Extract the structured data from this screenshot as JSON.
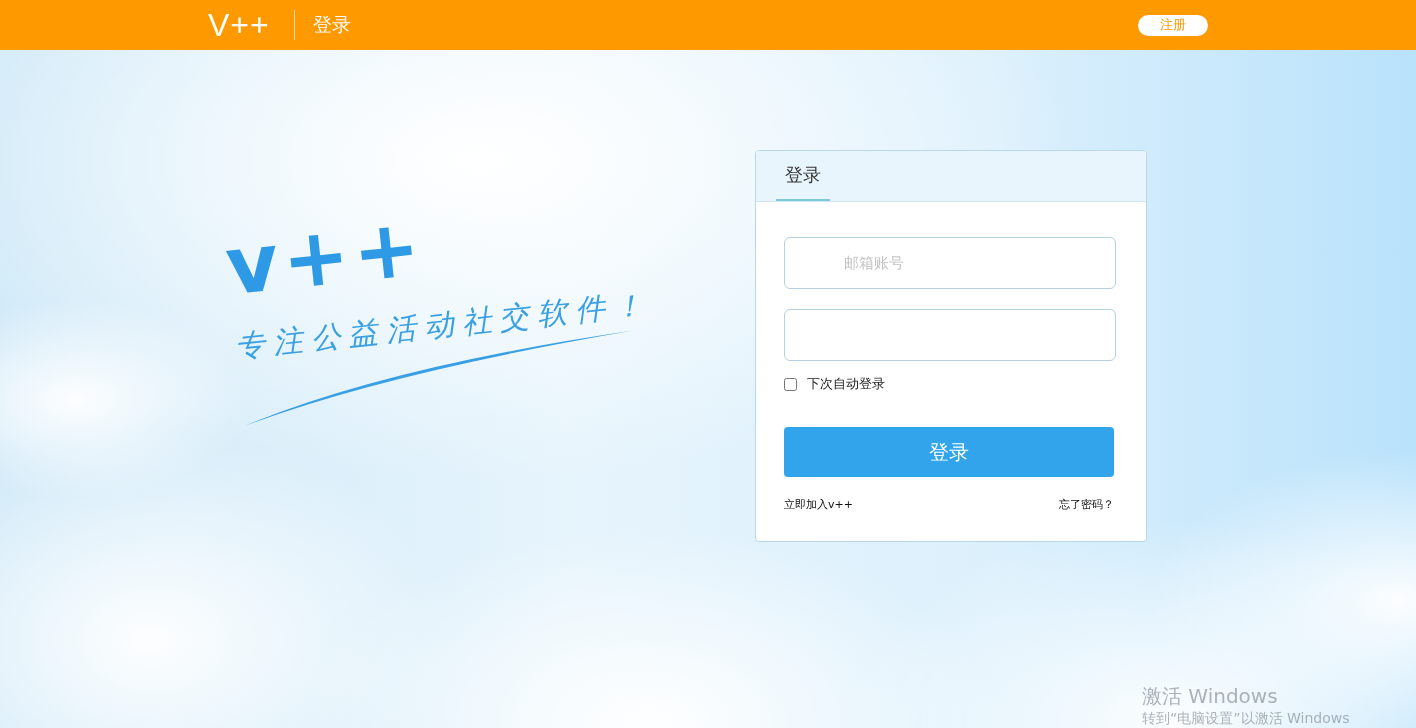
{
  "header": {
    "logo": "V++",
    "title": "登录",
    "register_button": "注册"
  },
  "hero": {
    "logo": "v++",
    "slogan": "专注公益活动社交软件！"
  },
  "login_card": {
    "tabs": [
      {
        "label": "登录",
        "selected": true
      }
    ],
    "email_field": {
      "placeholder": "邮箱账号"
    },
    "remember": {
      "label": "下次自动登录",
      "checked": false
    },
    "submit_button": "登录",
    "join_link": "立即加入v++",
    "forgot_link": "忘了密码？"
  },
  "os_overlay": {
    "title": "激活 Windows",
    "message": "转到“电脑设置”以激活 Windows"
  }
}
